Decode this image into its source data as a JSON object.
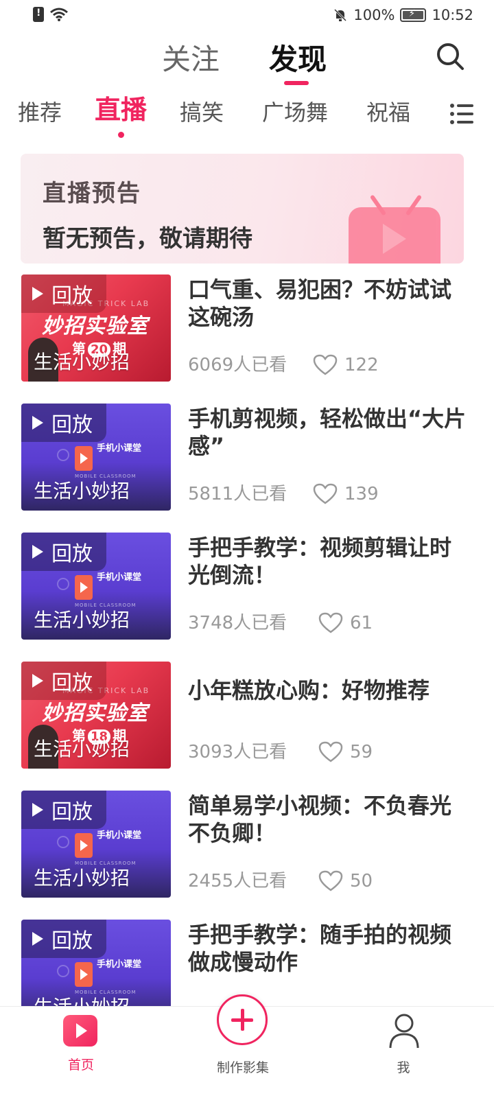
{
  "status_bar": {
    "battery": "100%",
    "time": "10:52"
  },
  "top_tabs": {
    "follow": "关注",
    "discover": "发现",
    "active": "discover"
  },
  "categories": [
    "推荐",
    "直播",
    "搞笑",
    "广场舞",
    "祝福"
  ],
  "active_category": "直播",
  "banner": {
    "title": "直播预告",
    "subtitle": "暂无预告，敬请期待"
  },
  "replay_label": "回放",
  "feed": [
    {
      "title": "口气重、易犯困？不妨试试这碗汤",
      "channel": "生活小妙招",
      "views": "6069人已看",
      "likes": "122",
      "thumb": "red",
      "thumb_logo": "妙招实验室",
      "thumb_lab": "MAGIC TRICK LAB",
      "issue_prefix": "第",
      "issue_num": "20",
      "issue_suffix": "期"
    },
    {
      "title": "手机剪视频，轻松做出“大片感”",
      "channel": "生活小妙招",
      "views": "5811人已看",
      "likes": "139",
      "thumb": "purple",
      "thumb_logo": "手机小课堂",
      "thumb_sub": "MOBILE CLASSROOM"
    },
    {
      "title": "手把手教学：视频剪辑让时光倒流！",
      "channel": "生活小妙招",
      "views": "3748人已看",
      "likes": "61",
      "thumb": "purple",
      "thumb_logo": "手机小课堂",
      "thumb_sub": "MOBILE CLASSROOM"
    },
    {
      "title": "小年糕放心购：好物推荐",
      "channel": "生活小妙招",
      "views": "3093人已看",
      "likes": "59",
      "thumb": "red",
      "thumb_logo": "妙招实验室",
      "thumb_lab": "MAGIC TRICK LAB",
      "issue_prefix": "第",
      "issue_num": "18",
      "issue_suffix": "期"
    },
    {
      "title": "简单易学小视频：不负春光不负卿！",
      "channel": "生活小妙招",
      "views": "2455人已看",
      "likes": "50",
      "thumb": "purple",
      "thumb_logo": "手机小课堂",
      "thumb_sub": "MOBILE CLASSROOM"
    },
    {
      "title": "手把手教学：随手拍的视频做成慢动作",
      "channel": "生活小妙招",
      "views": "",
      "likes": "",
      "thumb": "purple",
      "thumb_logo": "手机小课堂",
      "thumb_sub": "MOBILE CLASSROOM"
    }
  ],
  "bottom_nav": {
    "home": "首页",
    "make": "制作影集",
    "me": "我",
    "active": "home"
  },
  "colors": {
    "accent": "#f0245f",
    "text_primary": "#333333",
    "text_secondary": "#999999"
  },
  "icons": {
    "search": "search-icon",
    "menu": "list-menu-icon",
    "heart": "heart-icon",
    "play": "play-icon"
  }
}
